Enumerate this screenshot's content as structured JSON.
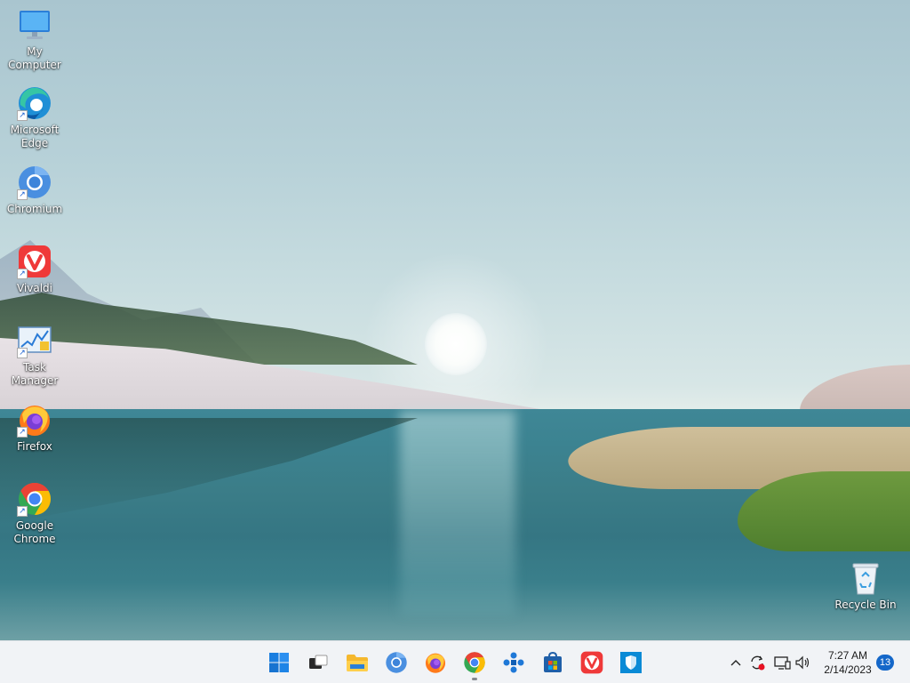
{
  "desktop": {
    "icons": [
      {
        "label": "My Computer",
        "icon": "monitor-icon",
        "shortcut": false
      },
      {
        "label": "Microsoft\nEdge",
        "icon": "edge-icon",
        "shortcut": true
      },
      {
        "label": "Chromium",
        "icon": "chromium-icon",
        "shortcut": true
      },
      {
        "label": "Vivaldi",
        "icon": "vivaldi-icon",
        "shortcut": true
      },
      {
        "label": "Task Manager",
        "icon": "task-manager-icon",
        "shortcut": true
      },
      {
        "label": "Firefox",
        "icon": "firefox-icon",
        "shortcut": true
      },
      {
        "label": "Google\nChrome",
        "icon": "chrome-icon",
        "shortcut": true
      }
    ],
    "recycle_bin": {
      "label": "Recycle Bin",
      "icon": "recycle-bin-icon"
    }
  },
  "taskbar": {
    "apps": [
      {
        "name": "Start",
        "icon": "windows-start-icon"
      },
      {
        "name": "Task View",
        "icon": "task-view-icon"
      },
      {
        "name": "File Explorer",
        "icon": "folder-icon"
      },
      {
        "name": "Chromium",
        "icon": "chromium-icon"
      },
      {
        "name": "Firefox",
        "icon": "firefox-icon"
      },
      {
        "name": "Google Chrome",
        "icon": "chrome-icon",
        "active": true
      },
      {
        "name": "Network",
        "icon": "network-app-icon"
      },
      {
        "name": "Microsoft Store",
        "icon": "store-icon"
      },
      {
        "name": "Vivaldi",
        "icon": "vivaldi-icon"
      },
      {
        "name": "Windows Security",
        "icon": "security-shield-icon"
      }
    ],
    "tray": {
      "chevron": "chevron-up-icon",
      "sync": "sync-error-icon",
      "display": "display-icon",
      "volume": "volume-icon"
    },
    "clock": {
      "time": "7:27 AM",
      "date": "2/14/2023"
    },
    "notification_count": "13"
  },
  "colors": {
    "taskbar_bg": "#f1f3f6",
    "accent": "#1467c9"
  }
}
